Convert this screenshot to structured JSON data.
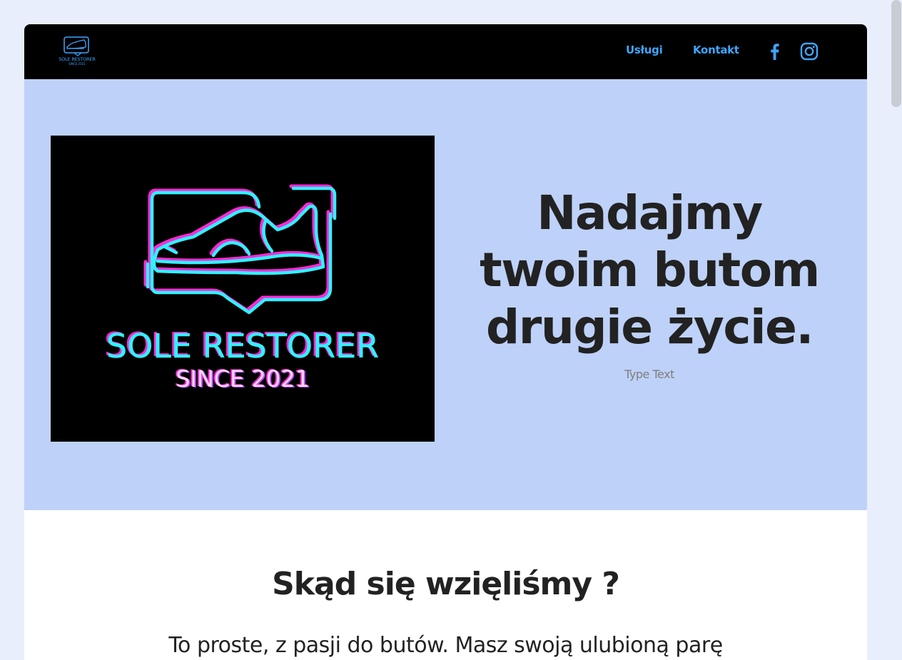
{
  "nav": {
    "logo_line1": "SOLE RESTORER",
    "logo_line2": "SINCE 2021",
    "links": [
      {
        "label": "Usługi"
      },
      {
        "label": "Kontakt"
      }
    ],
    "social": [
      "facebook-icon",
      "instagram-icon"
    ],
    "accent_color": "#3ea6ff"
  },
  "hero": {
    "image_text_line1": "SOLE RESTORER",
    "image_text_line2": "SINCE 2021",
    "headline_line1": "Nadajmy",
    "headline_line2": "twoim butom",
    "headline_line3": "drugie życie.",
    "subtext": "Type Text",
    "background_color": "#bed1f8"
  },
  "about": {
    "title": "Skąd się wzięliśmy ?",
    "text": "To proste, z pasji do butów. Masz swoją ulubioną parę"
  }
}
